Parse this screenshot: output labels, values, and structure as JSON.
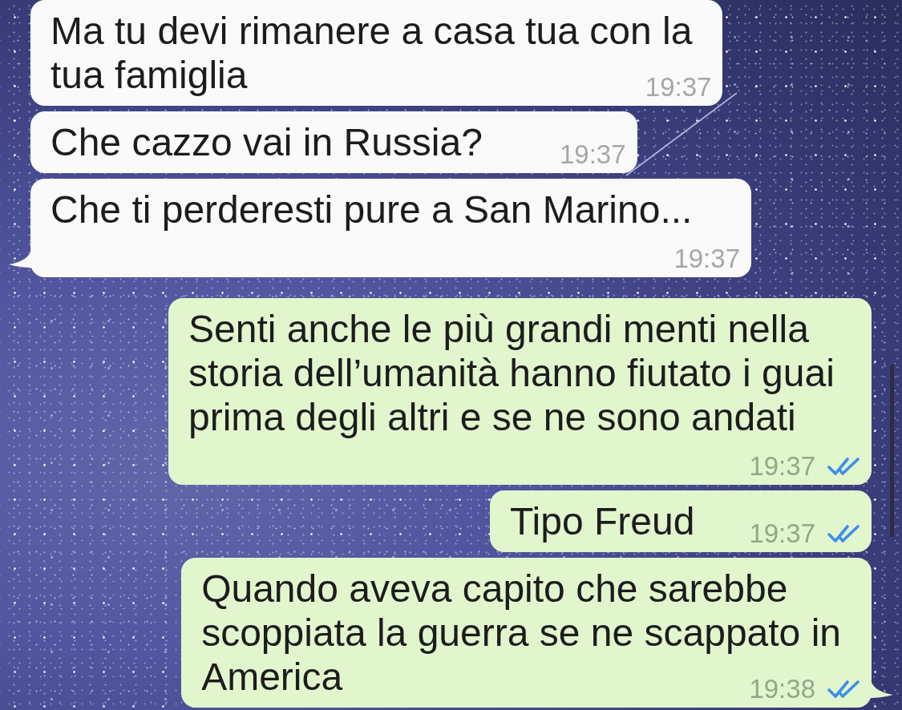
{
  "messages": [
    {
      "outgoing": false,
      "lines": [
        "Ma tu devi rimanere a casa tua con la",
        "tua famiglia"
      ],
      "time": "19:37",
      "tail": false
    },
    {
      "outgoing": false,
      "lines": [
        "Che cazzo vai in Russia?"
      ],
      "time": "19:37",
      "tail": false
    },
    {
      "outgoing": false,
      "lines": [
        "Che ti perderesti pure a San Marino..."
      ],
      "time": "19:37",
      "tail": true
    },
    {
      "outgoing": true,
      "lines": [
        "Senti anche le più grandi menti nella",
        "storia dell’umanità hanno fiutato i guai",
        "prima degli altri e se ne sono andati"
      ],
      "time": "19:37",
      "read": true,
      "tail": false
    },
    {
      "outgoing": true,
      "lines": [
        "Tipo Freud"
      ],
      "time": "19:37",
      "read": true,
      "tail": false
    },
    {
      "outgoing": true,
      "lines": [
        "Quando aveva capito che sarebbe",
        "scoppiata la guerra se ne scappato in",
        "America"
      ],
      "time": "19:38",
      "read": true,
      "tail": true
    }
  ]
}
